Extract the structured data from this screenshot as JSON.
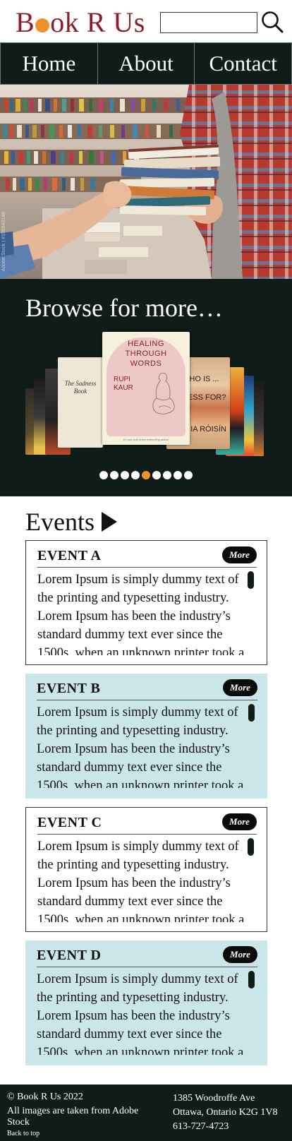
{
  "header": {
    "logo_prefix": "B",
    "logo_suffix": "ok R Us",
    "search_placeholder": ""
  },
  "nav": {
    "items": [
      {
        "label": "Home"
      },
      {
        "label": "About"
      },
      {
        "label": "Contact"
      }
    ]
  },
  "hero": {
    "watermark": "Adobe Stock | #196943148"
  },
  "browse": {
    "title": "Browse for more…",
    "featured_book": {
      "title": "HEALING THROUGH WORDS",
      "author": "RUPI KAUR",
      "tagline": "#1 new york times bestselling author"
    },
    "side_books": [
      {
        "title": "The Sadness Book"
      },
      {
        "title": "WHO IS ... NESS FOR?",
        "author": "... IA RÓISÍN"
      }
    ],
    "dots_total": 9,
    "dots_active_index": 4
  },
  "events": {
    "title": "Events",
    "more_label": "More",
    "items": [
      {
        "title": "EVENT A",
        "style": "white",
        "body": "Lorem Ipsum is simply dummy text of the printing and typesetting industry. Lorem Ipsum has been the industry’s standard dummy text ever since the 1500s, when an unknown printer took a galley of type and scrambled it."
      },
      {
        "title": "EVENT B",
        "style": "blue",
        "body": "Lorem Ipsum is simply dummy text of the printing and typesetting industry. Lorem Ipsum has been the industry’s standard dummy text ever since the 1500s, when an unknown printer took a galley of type and scrambled it."
      },
      {
        "title": "EVENT C",
        "style": "white",
        "body": "Lorem Ipsum is simply dummy text of the printing and typesetting industry. Lorem Ipsum has been the industry’s standard dummy text ever since the 1500s, when an unknown printer took a galley of type and scrambled it."
      },
      {
        "title": "EVENT D",
        "style": "blue",
        "body": "Lorem Ipsum is simply dummy text of the printing and typesetting industry. Lorem Ipsum has been the industry’s standard dummy text ever since the 1500s, when an unknown printer took a galley of type and scrambled it."
      }
    ]
  },
  "footer": {
    "copyright": "© Book R Us 2022",
    "credit": "All images are taken from Adobe Stock",
    "back_to_top": "Back to top",
    "address_line1": "1385 Woodroffe Ave",
    "address_line2": "Ottawa, Ontario K2G 1V8",
    "phone": "613-727-4723"
  },
  "colors": {
    "brand": "#8b1e2a",
    "accent": "#f0902a",
    "dark": "#0f1c17",
    "event_blue": "#cae6e8"
  }
}
